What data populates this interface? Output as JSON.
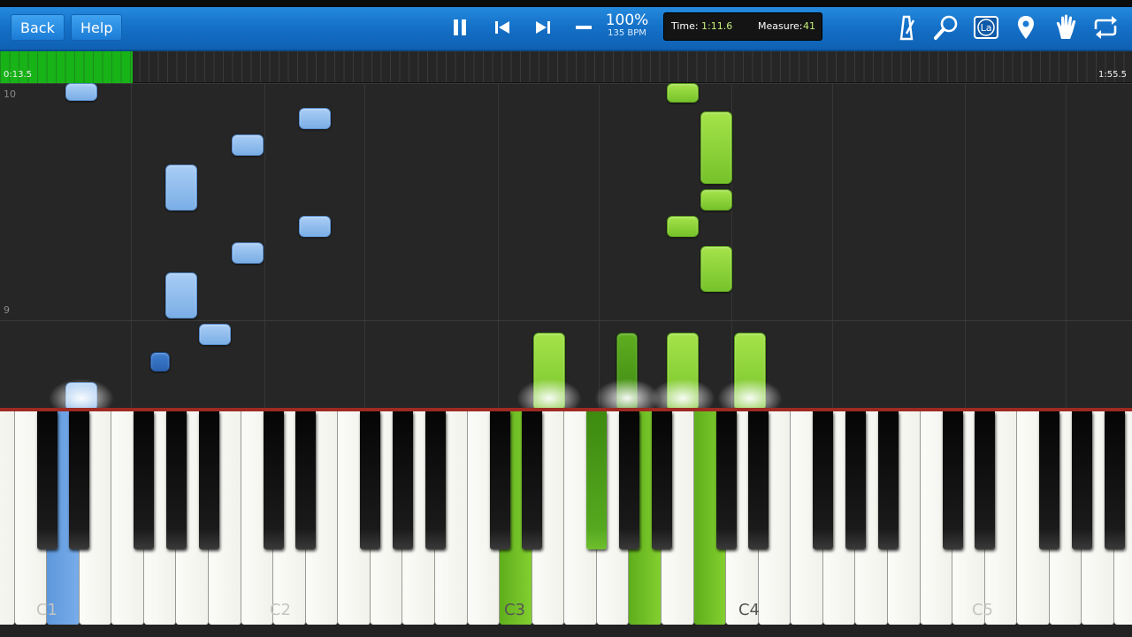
{
  "toolbar": {
    "back_label": "Back",
    "help_label": "Help",
    "tempo_percent": "100%",
    "tempo_bpm": "135 BPM",
    "time_label": "Time:",
    "time_value": "1:11.6",
    "measure_label": "Measure:",
    "measure_value": "41",
    "icons": [
      "pause-icon",
      "skip-back-icon",
      "skip-forward-icon",
      "minus-icon",
      "metronome-icon",
      "zoom-icon",
      "label-icon",
      "location-pin-icon",
      "hand-icon",
      "loop-icon"
    ],
    "label_icon_text": "La",
    "accent_color": "#1a7ad4"
  },
  "timeline": {
    "start_time": "0:13.5",
    "end_time": "1:55.5",
    "progress_fraction": 0.117
  },
  "roll": {
    "measure_numbers": [
      "10",
      "9"
    ],
    "left_hand_color": "#8dbcef",
    "right_hand_color": "#8ed13b"
  },
  "keyboard": {
    "octave_labels": [
      "C1",
      "C2",
      "C3",
      "C4",
      "C5"
    ]
  }
}
